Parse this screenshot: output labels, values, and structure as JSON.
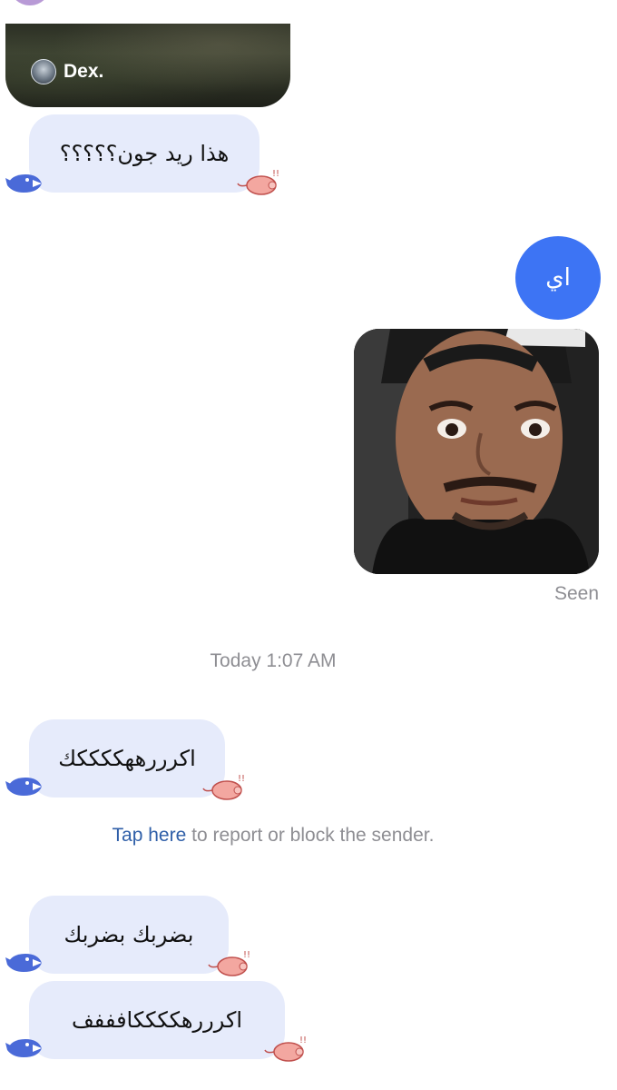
{
  "story": {
    "author": "Dex."
  },
  "messages": [
    {
      "text": "هذا ريد جون؟؟؟؟؟"
    },
    {
      "text": "اي"
    },
    {
      "text": "اكرررههككككك"
    },
    {
      "text": "بضربك بضربك"
    },
    {
      "text": "اكرررهككككافففف"
    }
  ],
  "status": {
    "seen": "Seen"
  },
  "divider": {
    "timestamp": "Today 1:07 AM"
  },
  "report": {
    "link_text": "Tap here",
    "rest_text": " to report or block the sender."
  },
  "colors": {
    "received_bubble": "#e6ebfb",
    "sent_bubble": "#3d74f4",
    "link": "#2f5fa8"
  },
  "icons": {
    "reaction_left": "whale-sticker-icon",
    "reaction_right": "pig-sticker-icon"
  }
}
